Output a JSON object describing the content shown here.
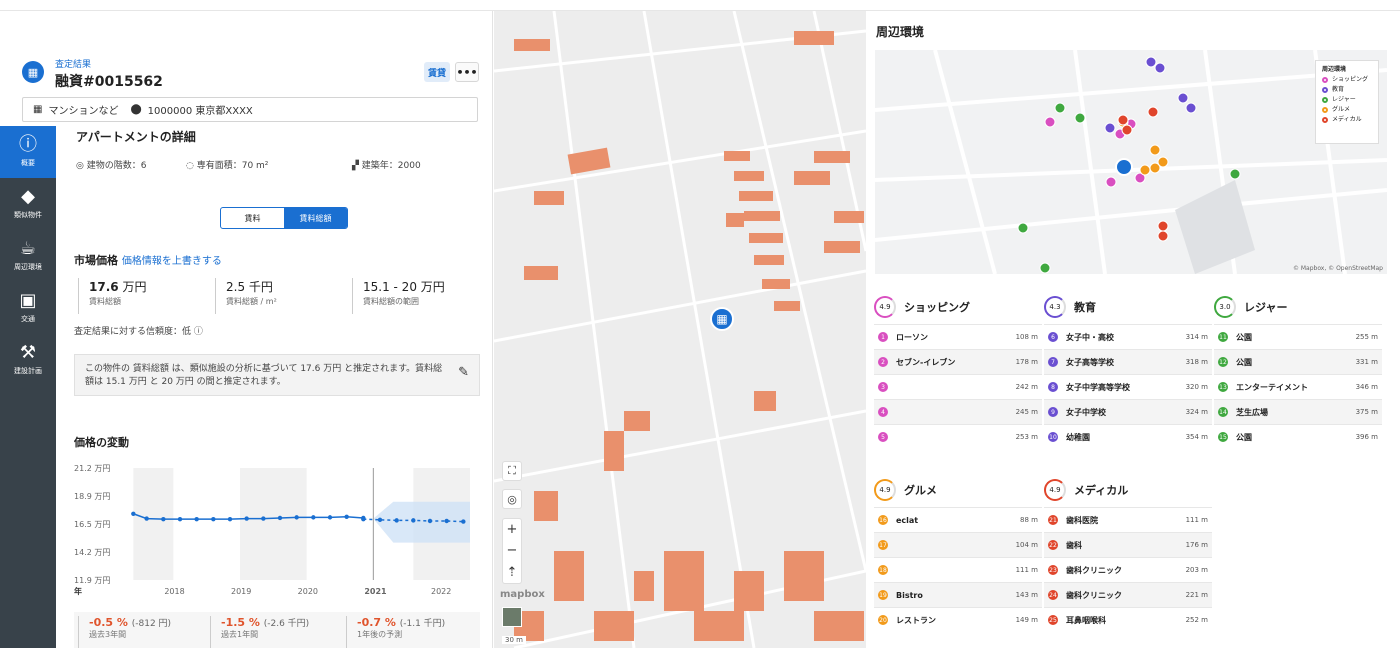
{
  "header": {
    "breadcrumb": "査定結果",
    "loan_id": "融資#0015562",
    "rent_button": "賃貸",
    "more_button": "•••",
    "property_type": "マンションなど",
    "postal_address": "1000000 東京都XXXX"
  },
  "sidebar": {
    "items": [
      {
        "label": "概要",
        "icon": "info-icon",
        "active": true
      },
      {
        "label": "類似物件",
        "icon": "tag-icon",
        "active": false
      },
      {
        "label": "周辺環境",
        "icon": "cup-icon",
        "active": false
      },
      {
        "label": "交通",
        "icon": "car-icon",
        "active": false
      },
      {
        "label": "建設計画",
        "icon": "crane-icon",
        "active": false
      }
    ]
  },
  "details": {
    "title": "アパートメントの詳細",
    "floors": "建物の階数：6",
    "area": "専有面積：70 m²",
    "year": "建築年：2000"
  },
  "toggle": {
    "left": "賃料",
    "right": "賃料総額"
  },
  "market": {
    "title": "市場価格",
    "override_link": "価格情報を上書きする",
    "kpis": [
      {
        "value": "17.6",
        "unit": "万円",
        "label": "賃料総額"
      },
      {
        "value": "2.5",
        "unit": "千円",
        "label": "賃料総額 / m²"
      },
      {
        "value": "15.1 - 20",
        "unit": "万円",
        "label": "賃料総額の範囲"
      }
    ],
    "confidence": "査定結果に対する信頼度：低",
    "description": "この物件の 賃料総額 は、類似施設の分析に基づいて 17.6 万円 と推定されます。賃料総額は 15.1 万円 と 20 万円 の間と推定されます。"
  },
  "price_change": {
    "title": "価格の変動",
    "items": [
      {
        "pct": "-0.5 %",
        "amt": "(-812 円)",
        "label": "過去3年間"
      },
      {
        "pct": "-1.5 %",
        "amt": "(-2.6 千円)",
        "label": "過去1年間"
      },
      {
        "pct": "-0.7 %",
        "amt": "(-1.1 千円)",
        "label": "1年後の予測"
      }
    ]
  },
  "chart_data": {
    "type": "line",
    "xlabel": "年",
    "ylabel": "",
    "x_ticks": [
      "2018",
      "2019",
      "2020",
      "2021",
      "2022"
    ],
    "y_ticks": [
      "21.2 万円",
      "18.9 万円",
      "16.5 万円",
      "14.2 万円",
      "11.9 万円"
    ],
    "ylim": [
      11.9,
      21.2
    ],
    "x_range": [
      2017.2,
      2022.45
    ],
    "series": [
      {
        "x": [
          2017.4,
          2017.6,
          2017.85,
          2018.1,
          2018.35,
          2018.6,
          2018.85,
          2019.1,
          2019.35,
          2019.6,
          2019.85,
          2020.1,
          2020.35,
          2020.6,
          2020.85
        ],
        "values": [
          17.4,
          17.0,
          16.95,
          16.95,
          16.95,
          16.95,
          16.95,
          17.0,
          17.0,
          17.05,
          17.1,
          17.1,
          17.1,
          17.15,
          17.05
        ]
      },
      {
        "x": [
          2020.85,
          2021.1,
          2021.35,
          2021.6,
          2021.85,
          2022.1,
          2022.35
        ],
        "values": [
          16.95,
          16.9,
          16.85,
          16.85,
          16.8,
          16.8,
          16.75
        ]
      }
    ],
    "forecast_band": {
      "x": [
        2021.0,
        2022.45
      ],
      "low": 15.0,
      "high": 18.4
    },
    "grid": false
  },
  "map": {
    "logo": "mapbox",
    "scale": "30 m"
  },
  "neighborhood": {
    "title": "周辺環境",
    "legend_title": "周辺環境",
    "legend": [
      {
        "label": "ショッピング",
        "color": "#d94fc0"
      },
      {
        "label": "教育",
        "color": "#6a4fd1"
      },
      {
        "label": "レジャー",
        "color": "#3fa83f"
      },
      {
        "label": "グルメ",
        "color": "#f29a1a"
      },
      {
        "label": "メディカル",
        "color": "#e0452b"
      }
    ],
    "attribution": "© Mapbox, © OpenStreetMap",
    "categories": [
      {
        "name": "ショッピング",
        "score": "4.9",
        "color": "#d94fc0",
        "rows": [
          {
            "n": "1",
            "name": "ローソン",
            "dist": "108 m"
          },
          {
            "n": "2",
            "name": "セブン-イレブン",
            "dist": "178 m"
          },
          {
            "n": "3",
            "name": "",
            "dist": "242 m"
          },
          {
            "n": "4",
            "name": "",
            "dist": "245 m"
          },
          {
            "n": "5",
            "name": "",
            "dist": "253 m"
          }
        ]
      },
      {
        "name": "教育",
        "score": "4.3",
        "color": "#6a4fd1",
        "rows": [
          {
            "n": "6",
            "name": "女子中・高校",
            "dist": "314 m"
          },
          {
            "n": "7",
            "name": "女子高等学校",
            "dist": "318 m"
          },
          {
            "n": "8",
            "name": "女子中学高等学校",
            "dist": "320 m"
          },
          {
            "n": "9",
            "name": "女子中学校",
            "dist": "324 m"
          },
          {
            "n": "10",
            "name": "幼稚園",
            "dist": "354 m"
          }
        ]
      },
      {
        "name": "レジャー",
        "score": "3.0",
        "color": "#3fa83f",
        "rows": [
          {
            "n": "11",
            "name": "公園",
            "dist": "255 m"
          },
          {
            "n": "12",
            "name": "公園",
            "dist": "331 m"
          },
          {
            "n": "13",
            "name": "エンターテイメント",
            "dist": "346 m"
          },
          {
            "n": "14",
            "name": "芝生広場",
            "dist": "375 m"
          },
          {
            "n": "15",
            "name": "公園",
            "dist": "396 m"
          }
        ]
      },
      {
        "name": "グルメ",
        "score": "4.9",
        "color": "#f29a1a",
        "rows": [
          {
            "n": "16",
            "name": "eclat",
            "dist": "88 m"
          },
          {
            "n": "17",
            "name": "",
            "dist": "104 m"
          },
          {
            "n": "18",
            "name": "",
            "dist": "111 m"
          },
          {
            "n": "19",
            "name": "Bistro",
            "dist": "143 m"
          },
          {
            "n": "20",
            "name": "レストラン",
            "dist": "149 m"
          }
        ]
      },
      {
        "name": "メディカル",
        "score": "4.9",
        "color": "#e0452b",
        "rows": [
          {
            "n": "21",
            "name": "歯科医院",
            "dist": "111 m"
          },
          {
            "n": "22",
            "name": "歯科",
            "dist": "176 m"
          },
          {
            "n": "23",
            "name": "歯科クリニック",
            "dist": "203 m"
          },
          {
            "n": "24",
            "name": "歯科クリニック",
            "dist": "221 m"
          },
          {
            "n": "25",
            "name": "耳鼻咽喉科",
            "dist": "252 m"
          }
        ]
      }
    ]
  }
}
